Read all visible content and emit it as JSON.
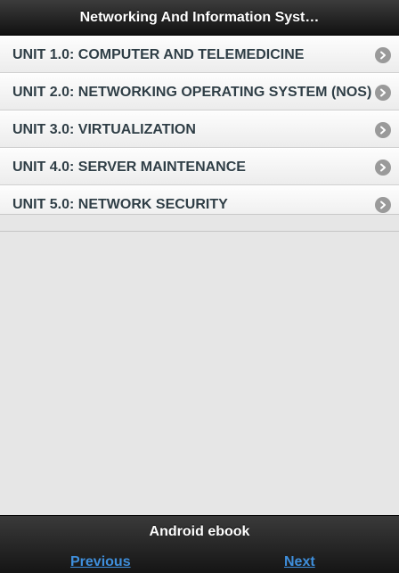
{
  "header": {
    "title": "Networking And Information Syst…"
  },
  "list": {
    "items": [
      {
        "label": "UNIT 1.0: COMPUTER AND TELEMEDICINE",
        "icon": "chevron-right-icon"
      },
      {
        "label": "UNIT 2.0: NETWORKING OPERATING SYSTEM (NOS)",
        "icon": "chevron-right-icon"
      },
      {
        "label": "UNIT 3.0: VIRTUALIZATION",
        "icon": "chevron-right-icon"
      },
      {
        "label": "UNIT 4.0: SERVER MAINTENANCE",
        "icon": "chevron-right-icon"
      },
      {
        "label": "UNIT 5.0: NETWORK SECURITY",
        "icon": "chevron-right-icon"
      }
    ]
  },
  "footer": {
    "title": "Android ebook",
    "previous_label": "Previous",
    "next_label": "Next"
  },
  "colors": {
    "header_bg": "#1e1e1e",
    "list_text": "#2f3e46",
    "arrow": "#9a9a9a",
    "link": "#3f8fdc",
    "page_bg": "#e6e6e6"
  }
}
